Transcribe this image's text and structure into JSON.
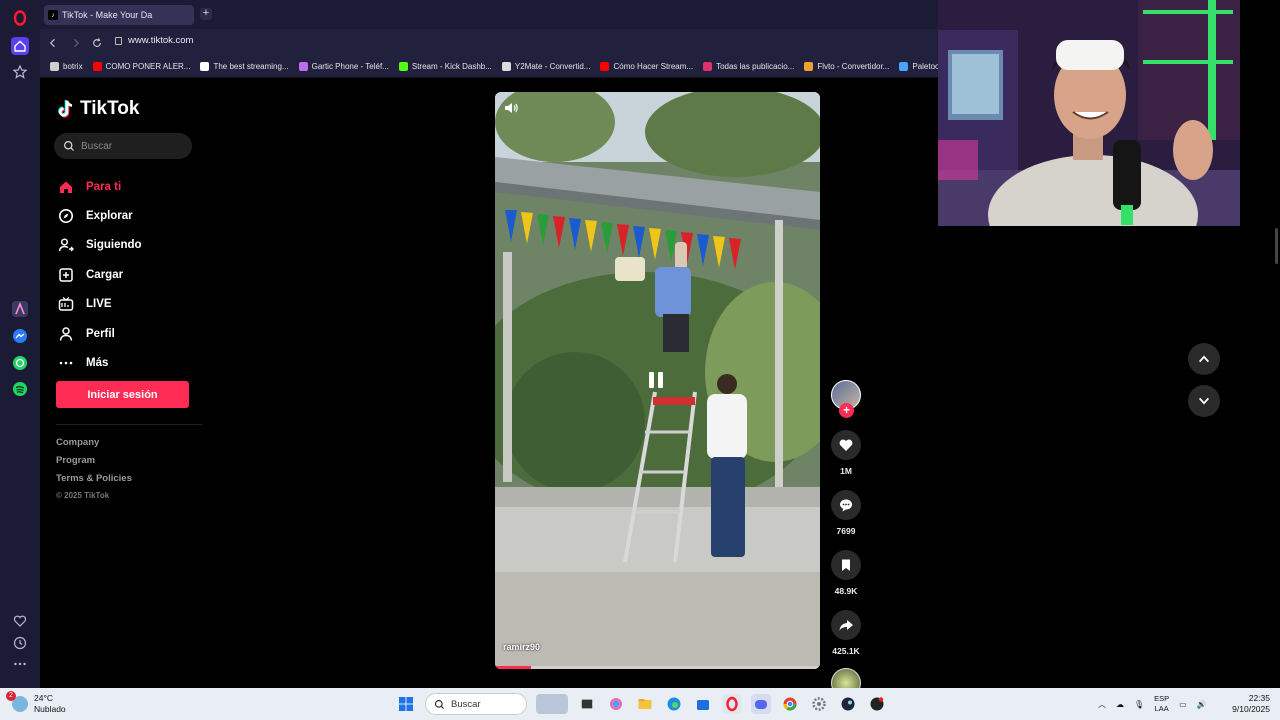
{
  "browser": {
    "tab_title": "TikTok - Make Your Da",
    "url": "www.tiktok.com",
    "bookmarks": [
      {
        "label": "botrix",
        "color": "#cfcfcf"
      },
      {
        "label": "COMO PONER ALER...",
        "color": "#ff0000"
      },
      {
        "label": "The best streaming...",
        "color": "#ffffff"
      },
      {
        "label": "Gartic Phone - Teléf...",
        "color": "#c06cf0"
      },
      {
        "label": "Stream - Kick Dashb...",
        "color": "#53fc18"
      },
      {
        "label": "Y2Mate - Convertid...",
        "color": "#dddddd"
      },
      {
        "label": "Cómo Hacer Stream...",
        "color": "#ff0000"
      },
      {
        "label": "Todas las publicacio...",
        "color": "#e1306c"
      },
      {
        "label": "Flvto - Convertidor...",
        "color": "#f0a030"
      },
      {
        "label": "Paletools",
        "color": "#4aa3ff"
      }
    ]
  },
  "sidebar": {
    "logo": "TikTok",
    "search_placeholder": "Buscar",
    "nav": [
      {
        "label": "Para ti",
        "icon": "home-icon",
        "active": true
      },
      {
        "label": "Explorar",
        "icon": "compass-icon",
        "active": false
      },
      {
        "label": "Siguiendo",
        "icon": "following-icon",
        "active": false
      },
      {
        "label": "Cargar",
        "icon": "upload-icon",
        "active": false
      },
      {
        "label": "LIVE",
        "icon": "live-icon",
        "active": false
      },
      {
        "label": "Perfil",
        "icon": "profile-icon",
        "active": false
      },
      {
        "label": "Más",
        "icon": "more-icon",
        "active": false
      }
    ],
    "login_label": "Iniciar sesión",
    "footer": {
      "company": "Company",
      "program": "Program",
      "terms": "Terms & Policies",
      "copyright": "© 2025 TikTok"
    }
  },
  "video": {
    "author": "ramirz90",
    "progress": 0.11,
    "likes": "1M",
    "comments": "7699",
    "saves": "48.9K",
    "shares": "425.1K"
  },
  "taskbar": {
    "temperature": "24°C",
    "weather": "Nublado",
    "weather_badge": "2",
    "search_label": "Buscar",
    "lang_top": "ESP",
    "lang_bottom": "LAA",
    "time": "22:35",
    "date": "9/10/2025"
  },
  "colors": {
    "accent": "#fe2c55",
    "opera_red": "#ff1b2d",
    "rail_bg": "#1c1b36"
  }
}
